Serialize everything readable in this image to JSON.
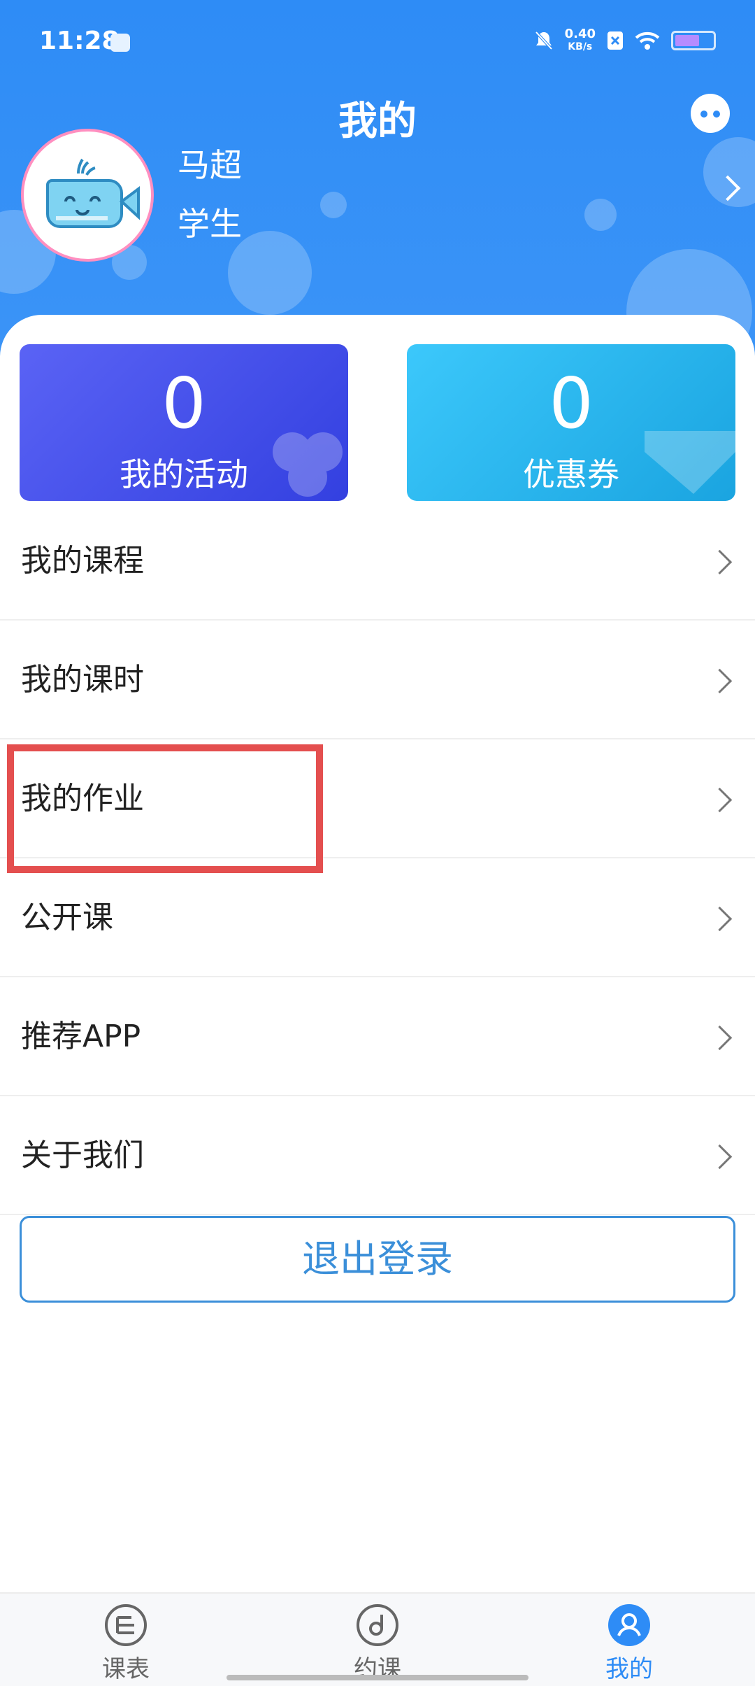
{
  "status_bar": {
    "time": "11:28",
    "net_speed_value": "0.40",
    "net_speed_unit": "KB/s"
  },
  "header": {
    "title": "我的",
    "user_name": "马超",
    "user_role": "学生"
  },
  "cards": {
    "activities": {
      "count": "0",
      "label": "我的活动"
    },
    "coupons": {
      "count": "0",
      "label": "优惠券"
    }
  },
  "menu": {
    "items": [
      {
        "label": "我的课程"
      },
      {
        "label": "我的课时"
      },
      {
        "label": "我的作业"
      },
      {
        "label": "公开课"
      },
      {
        "label": "推荐APP"
      },
      {
        "label": "关于我们"
      }
    ]
  },
  "logout_label": "退出登录",
  "tabbar": {
    "tabs": [
      {
        "label": "课表",
        "icon": "schedule-icon"
      },
      {
        "label": "约课",
        "icon": "book-class-icon"
      },
      {
        "label": "我的",
        "icon": "profile-icon",
        "active": true
      }
    ]
  },
  "colors": {
    "header_bg": "#2e8cf6",
    "accent": "#3b8fd9",
    "highlight": "#e44f4f"
  }
}
